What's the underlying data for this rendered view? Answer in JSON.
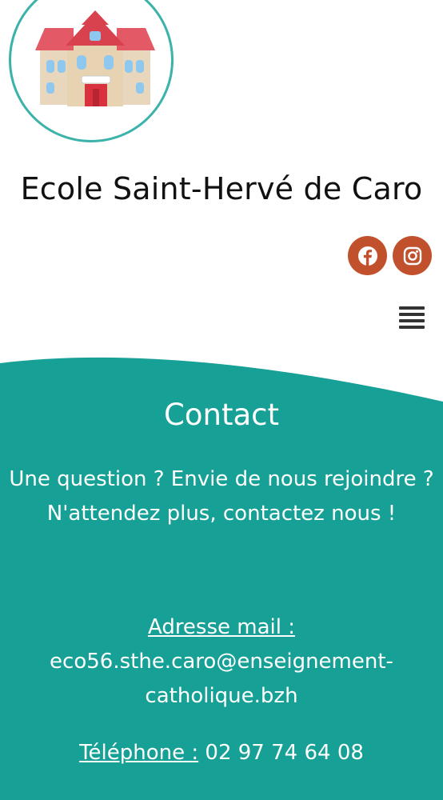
{
  "header": {
    "site_title": "Ecole Saint-Hervé de Caro"
  },
  "social": [
    {
      "name": "facebook-icon"
    },
    {
      "name": "instagram-icon"
    }
  ],
  "colors": {
    "teal": "#17a096",
    "social": "#c1512d",
    "logo_ring": "#3bb3aa"
  },
  "contact": {
    "title": "Contact",
    "intro": "Une question ? Envie de nous rejoindre ? N'attendez plus, contactez nous !",
    "mail_label": "Adresse mail :",
    "mail_value": "eco56.sthe.caro@enseignement-catholique.bzh",
    "phone_label": "Téléphone :",
    "phone_value": " 02 97 74 64 08"
  }
}
